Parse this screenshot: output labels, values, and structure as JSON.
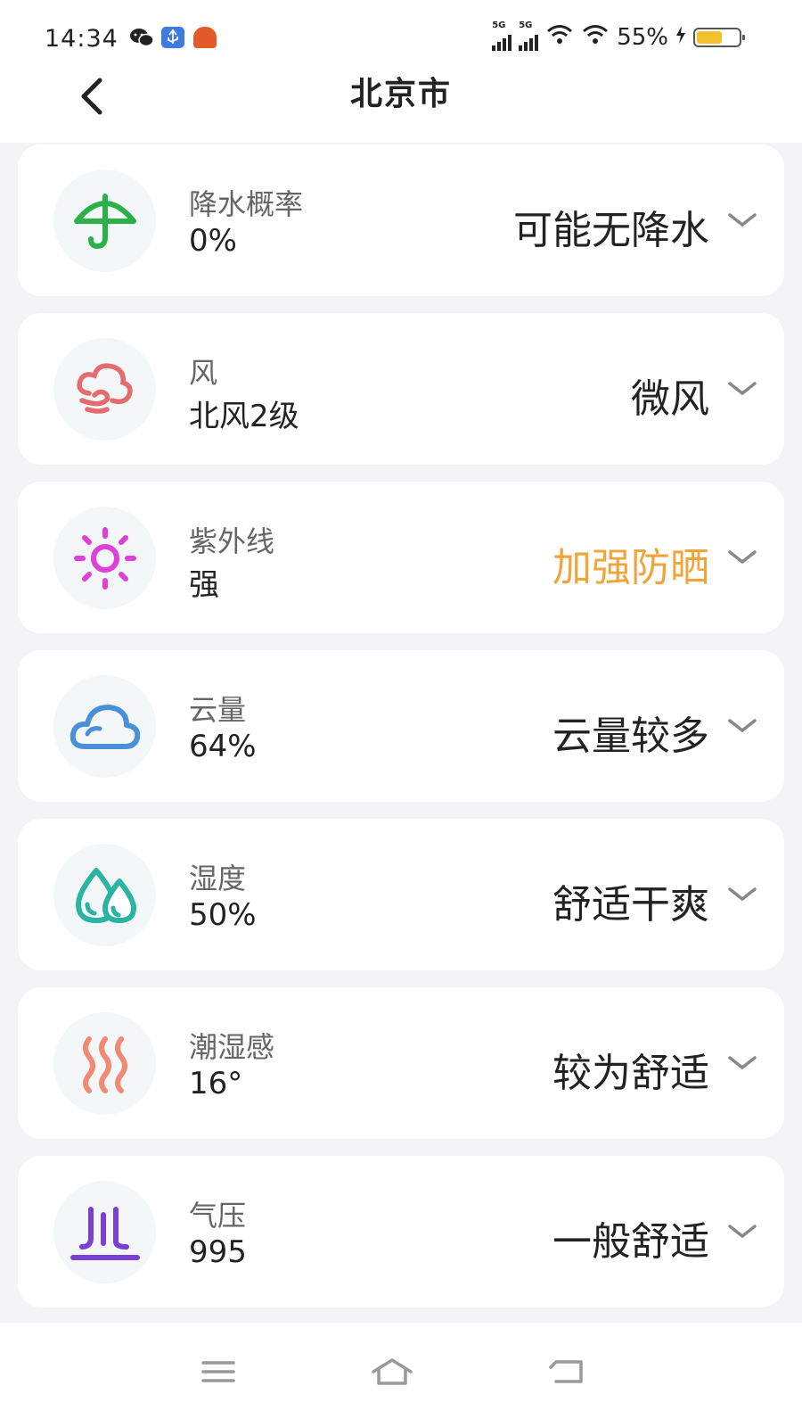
{
  "status": {
    "time": "14:34",
    "battery_text": "55%",
    "battery_level": 0.55,
    "network_labels": [
      "5G",
      "5G"
    ]
  },
  "header": {
    "title": "北京市",
    "back_icon": "chevron-left-icon"
  },
  "cards": [
    {
      "icon": "umbrella-icon",
      "icon_color": "#2bb04a",
      "label": "降水概率",
      "value": "0%",
      "description": "可能无降水",
      "desc_color": "#222222"
    },
    {
      "icon": "wind-cloud-icon",
      "icon_color": "#e56b6f",
      "label": "风",
      "value": "北风2级",
      "description": "微风",
      "desc_color": "#222222"
    },
    {
      "icon": "sun-icon",
      "icon_color": "#e040d9",
      "label": "紫外线",
      "value": "强",
      "description": "加强防晒",
      "desc_color": "#f0a43a"
    },
    {
      "icon": "cloud-icon",
      "icon_color": "#4a90d9",
      "label": "云量",
      "value": "64%",
      "description": "云量较多",
      "desc_color": "#222222"
    },
    {
      "icon": "droplets-icon",
      "icon_color": "#2bb3a3",
      "label": "湿度",
      "value": "50%",
      "description": "舒适干爽",
      "desc_color": "#222222"
    },
    {
      "icon": "heat-waves-icon",
      "icon_color": "#f08a73",
      "label": "潮湿感",
      "value": "16°",
      "description": "较为舒适",
      "desc_color": "#222222"
    },
    {
      "icon": "pressure-icon",
      "icon_color": "#7b3fd6",
      "label": "气压",
      "value": "995",
      "description": "一般舒适",
      "desc_color": "#222222"
    }
  ],
  "navbar": {
    "items": [
      "menu-icon",
      "home-icon",
      "back-icon"
    ]
  }
}
